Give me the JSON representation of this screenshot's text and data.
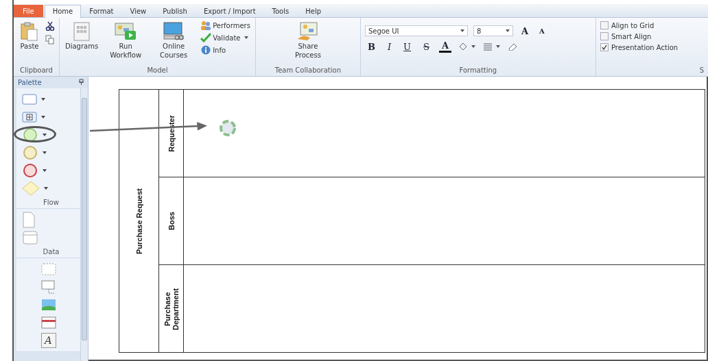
{
  "tabs": [
    {
      "label": "File",
      "kind": "file",
      "selected": false
    },
    {
      "label": "Home",
      "kind": "tab",
      "selected": true
    },
    {
      "label": "Format",
      "kind": "tab",
      "selected": false
    },
    {
      "label": "View",
      "kind": "tab",
      "selected": false
    },
    {
      "label": "Publish",
      "kind": "tab",
      "selected": false
    },
    {
      "label": "Export / Import",
      "kind": "tab",
      "selected": false
    },
    {
      "label": "Tools",
      "kind": "tab",
      "selected": false
    },
    {
      "label": "Help",
      "kind": "tab",
      "selected": false
    }
  ],
  "ribbon": {
    "groups": [
      {
        "label": "Clipboard",
        "items": [
          {
            "kind": "large",
            "label": "Paste"
          },
          {
            "kind": "icons"
          }
        ]
      },
      {
        "label": "Model",
        "items": [
          {
            "kind": "large",
            "label": "Diagrams"
          },
          {
            "kind": "large",
            "label": "Run Workflow"
          },
          {
            "kind": "large",
            "label": "Online Courses"
          },
          {
            "kind": "stack",
            "buttons": [
              {
                "label": "Performers",
                "dropdown": false
              },
              {
                "label": "Validate",
                "dropdown": true
              },
              {
                "label": "Info",
                "dropdown": false
              }
            ]
          }
        ]
      },
      {
        "label": "Team Collaboration",
        "items": [
          {
            "kind": "large",
            "label": "Share Process"
          }
        ]
      },
      {
        "label": "Formatting",
        "items": [
          {
            "kind": "format",
            "font": "Segoe UI",
            "size": "8",
            "grow": "A",
            "shrink": "A",
            "styles": [
              "B",
              "I",
              "U",
              "S"
            ],
            "font_color_glyph": "A"
          }
        ]
      },
      {
        "label": "S",
        "items": [
          {
            "kind": "checks",
            "checks": [
              {
                "label": "Align to Grid",
                "checked": false
              },
              {
                "label": "Smart Align",
                "checked": false
              },
              {
                "label": "Presentation Action",
                "checked": true
              }
            ]
          }
        ]
      }
    ]
  },
  "palette": {
    "title": "Palette",
    "sections": [
      {
        "label": "Flow",
        "items": [
          {
            "kind": "task",
            "highlighted": false
          },
          {
            "kind": "subprocess",
            "highlighted": false
          },
          {
            "kind": "start",
            "highlighted": true
          },
          {
            "kind": "intermediate",
            "highlighted": false
          },
          {
            "kind": "end",
            "highlighted": false
          },
          {
            "kind": "gateway",
            "highlighted": false
          }
        ]
      },
      {
        "label": "Data",
        "items": [
          {
            "kind": "document",
            "highlighted": false
          },
          {
            "kind": "datastore",
            "highlighted": false
          }
        ]
      },
      {
        "items": [
          {
            "kind": "group",
            "highlighted": false
          },
          {
            "kind": "annotation",
            "highlighted": false
          },
          {
            "kind": "image",
            "highlighted": false
          },
          {
            "kind": "frame",
            "highlighted": false
          },
          {
            "kind": "text",
            "glyph": "A",
            "highlighted": false
          }
        ]
      }
    ]
  },
  "pool": {
    "label": "Purchase Request",
    "lanes": [
      {
        "label": "Requester"
      },
      {
        "label": "Boss"
      },
      {
        "label": "Purchase Department"
      }
    ]
  }
}
